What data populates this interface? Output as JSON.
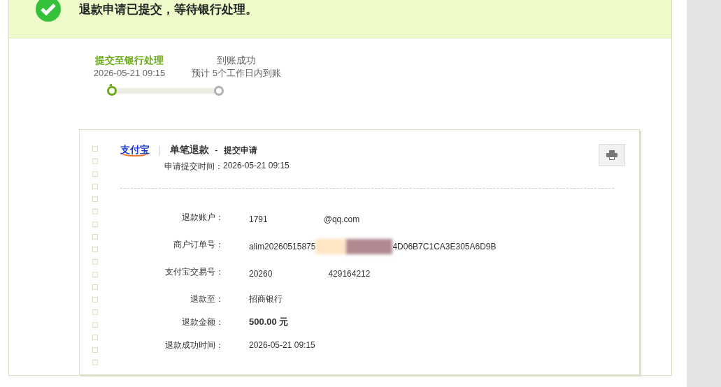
{
  "banner": {
    "message": "退款申请已提交，等待银行处理。"
  },
  "progress": {
    "steps": [
      {
        "title": "提交至银行处理",
        "note": "2026-05-21 09:15",
        "done": true
      },
      {
        "title": "到账成功",
        "note": "预计 5个工作日内到账",
        "done": false
      }
    ]
  },
  "receipt": {
    "logo": "支付宝",
    "title": "单笔退款",
    "title_separator": "-",
    "subtitle": "提交申请",
    "submit_label": "申请提交时间：",
    "submit_time": "2026-05-21 09:15",
    "rows": [
      {
        "label": "退款账户：",
        "parts": [
          "1791",
          "@qq.com"
        ],
        "bold": false
      },
      {
        "label": "商户订单号：",
        "parts": [
          "alim20260515875",
          "4D06B7C1CA3E305A6D9B"
        ],
        "bold": false
      },
      {
        "label": "支付宝交易号：",
        "parts": [
          "20260",
          "429164212"
        ],
        "bold": false
      },
      {
        "label": "退款至：",
        "parts": [
          "招商银行"
        ],
        "bold": false
      },
      {
        "label": "退款金额：",
        "parts": [
          "500.00 元"
        ],
        "bold": true
      },
      {
        "label": "退款成功时间：",
        "parts": [
          "2026-05-21 09:15"
        ],
        "bold": false
      }
    ]
  }
}
